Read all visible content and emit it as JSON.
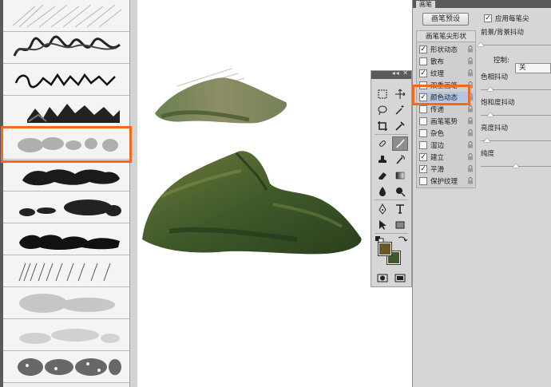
{
  "brush_panel": {
    "tab_label": "画笔",
    "preset_button": "画笔预设",
    "apply_per_tip_label": "应用每笔尖",
    "options_title": "画笔笔尖形状",
    "options": [
      {
        "label": "形状动态",
        "checked": true,
        "selected": false
      },
      {
        "label": "散布",
        "checked": false,
        "selected": false
      },
      {
        "label": "纹理",
        "checked": true,
        "selected": false
      },
      {
        "label": "双重画笔",
        "checked": false,
        "selected": false
      },
      {
        "label": "颜色动态",
        "checked": true,
        "selected": true
      },
      {
        "label": "传递",
        "checked": false,
        "selected": false
      },
      {
        "label": "画笔笔势",
        "checked": false,
        "selected": false
      },
      {
        "label": "杂色",
        "checked": false,
        "selected": false
      },
      {
        "label": "湿边",
        "checked": false,
        "selected": false
      },
      {
        "label": "建立",
        "checked": true,
        "selected": false
      },
      {
        "label": "平滑",
        "checked": true,
        "selected": false
      },
      {
        "label": "保护纹理",
        "checked": false,
        "selected": false
      }
    ],
    "settings": {
      "fg_bg_jitter_label": "前景/背景抖动",
      "control_label": "控制:",
      "control_value": "关",
      "hue_jitter_label": "色相抖动",
      "saturation_jitter_label": "饱和度抖动",
      "brightness_jitter_label": "亮度抖动",
      "purity_label": "纯度",
      "check_mark": "✓"
    }
  },
  "tools": {
    "header_label": "◂◂ ✕",
    "items": [
      "marquee-icon",
      "move-icon",
      "lasso-icon",
      "magic-wand-icon",
      "crop-icon",
      "eyedropper-icon",
      "healing-brush-icon",
      "brush-icon",
      "clone-stamp-icon",
      "history-brush-icon",
      "eraser-icon",
      "gradient-icon",
      "blur-icon",
      "dodge-icon",
      "pen-icon",
      "type-icon",
      "path-select-icon",
      "rectangle-icon",
      "hand-icon",
      "zoom-icon"
    ],
    "foreground_color": "#6b5628",
    "background_color": "#3e5a2a"
  },
  "colors": {
    "highlight": "#f06a1e",
    "panel_bg": "#d6d6d6"
  }
}
